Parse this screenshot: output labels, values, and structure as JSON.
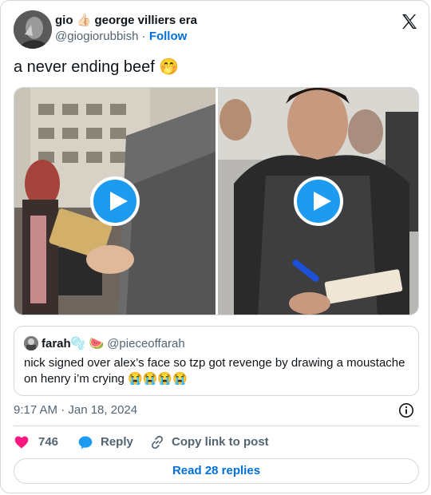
{
  "author": {
    "display_name": "gio 👍🏻 george villiers era",
    "handle": "@giogiorubbish",
    "separator": "·",
    "follow_label": "Follow"
  },
  "tweet": {
    "text": "a never ending beef 🤭"
  },
  "quoted": {
    "name": "farah🫧 🍉",
    "handle": "@pieceoffarah",
    "text": "nick signed over alex’s face so tzp got revenge by drawing a moustache on henry i’m crying 😭😭😭😭"
  },
  "meta": {
    "timestamp": "9:17 AM · Jan 18, 2024"
  },
  "actions": {
    "like_count": "746",
    "reply_label": "Reply",
    "copy_label": "Copy link to post"
  },
  "read_replies_label": "Read 28 replies",
  "colors": {
    "accent": "#1d9bf0",
    "link": "#006fd6",
    "heart": "#f91880",
    "secondary_text": "#536471",
    "border": "#cfd9de"
  },
  "icons": [
    "x-logo-icon",
    "play-icon",
    "heart-icon",
    "reply-icon",
    "link-icon",
    "info-icon"
  ]
}
